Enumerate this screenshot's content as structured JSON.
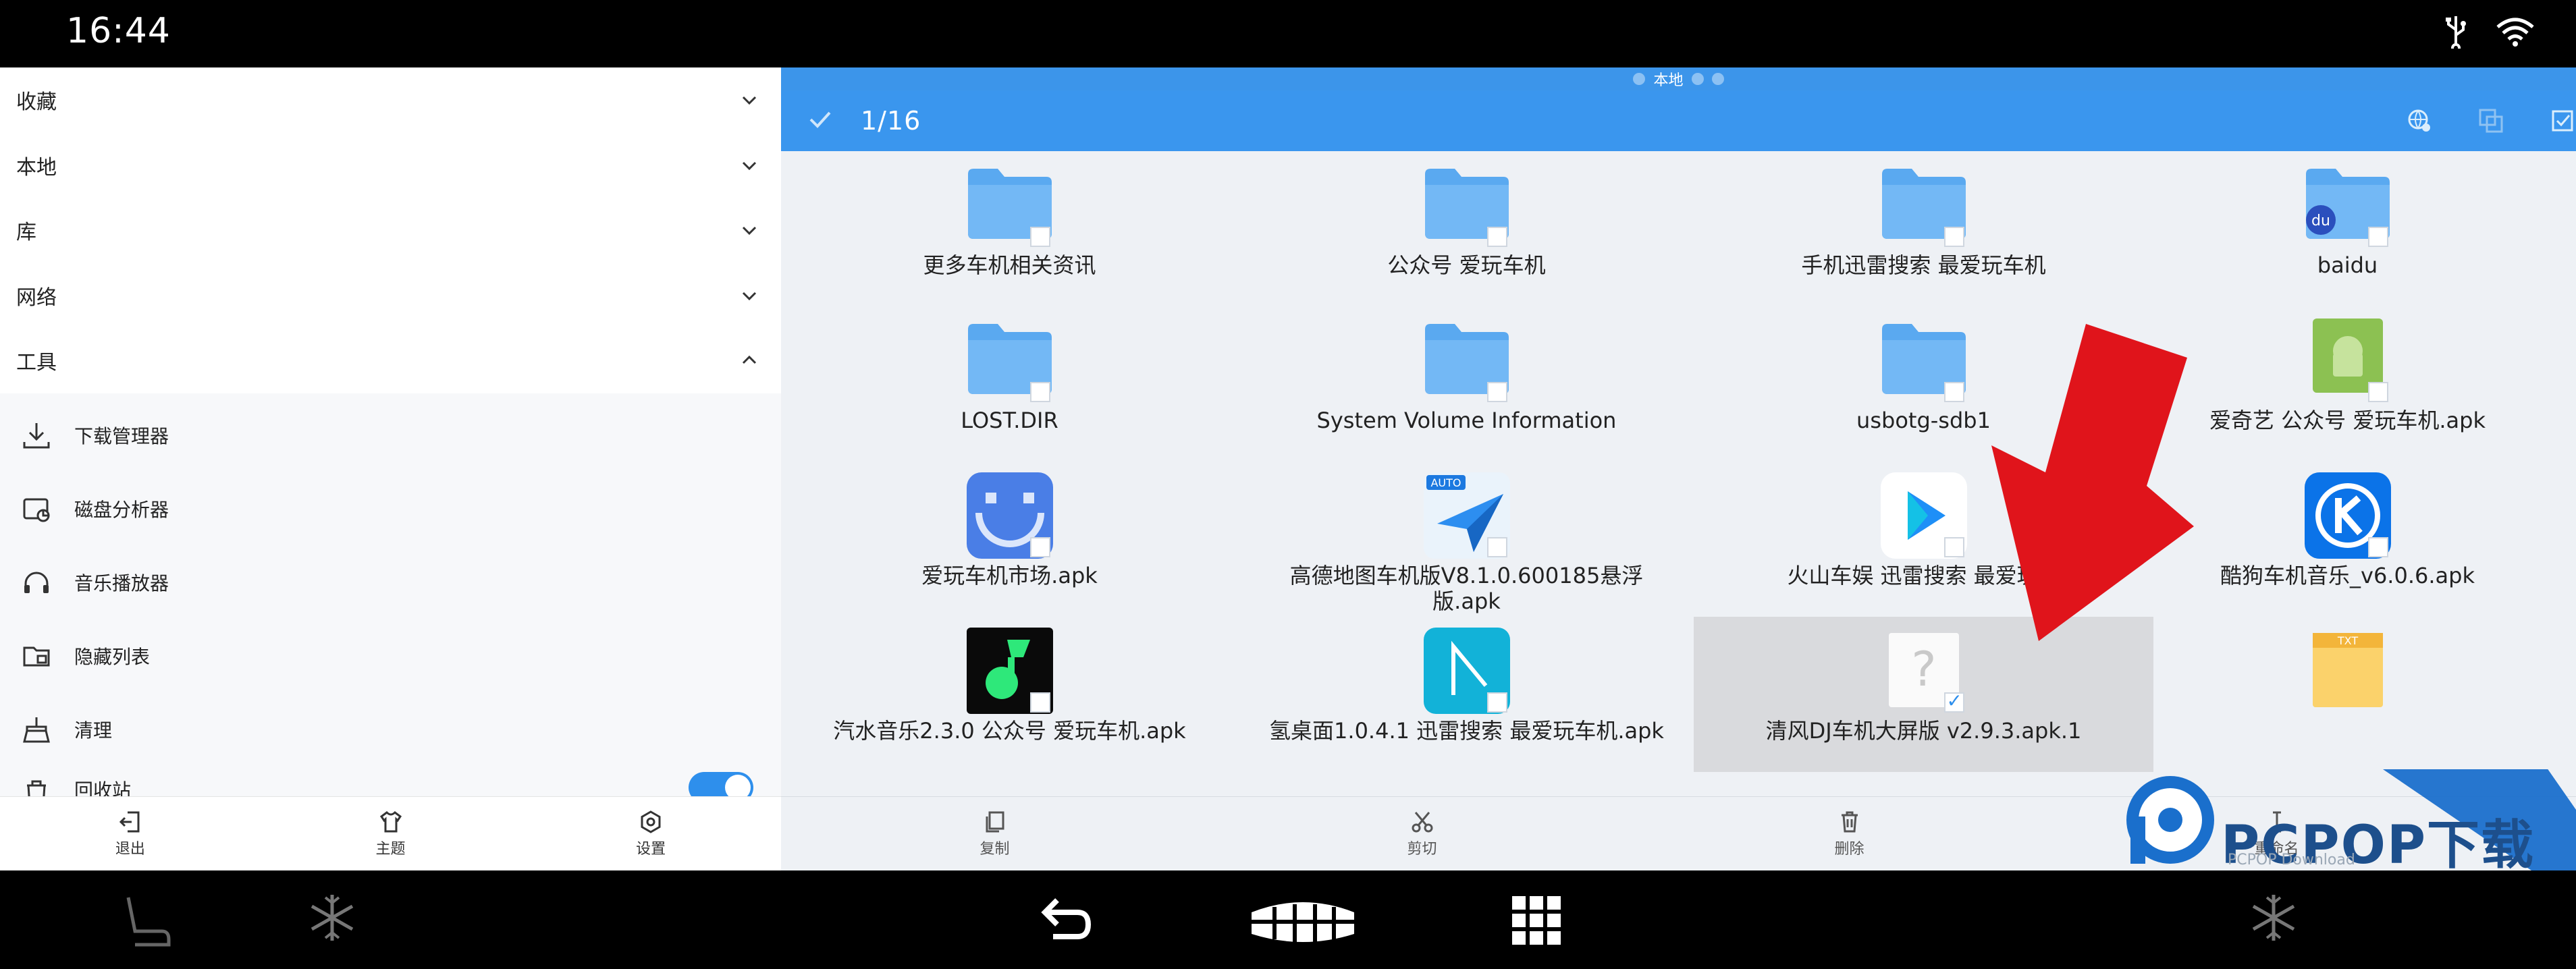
{
  "status_bar": {
    "time": "16:44",
    "icons": [
      "usb-icon",
      "wifi-icon"
    ]
  },
  "drawer": {
    "categories": [
      {
        "label": "收藏",
        "expanded": false
      },
      {
        "label": "本地",
        "expanded": false
      },
      {
        "label": "库",
        "expanded": false
      },
      {
        "label": "网络",
        "expanded": false
      },
      {
        "label": "工具",
        "expanded": true
      }
    ],
    "tools": [
      {
        "label": "下载管理器",
        "icon": "download-icon"
      },
      {
        "label": "磁盘分析器",
        "icon": "disk-analyzer-icon"
      },
      {
        "label": "音乐播放器",
        "icon": "headphones-icon"
      },
      {
        "label": "隐藏列表",
        "icon": "hidden-folder-icon"
      },
      {
        "label": "清理",
        "icon": "broom-icon"
      },
      {
        "label": "回收站",
        "icon": "trash-icon"
      }
    ],
    "bottom": [
      {
        "label": "退出",
        "icon": "exit-icon"
      },
      {
        "label": "主题",
        "icon": "shirt-icon"
      },
      {
        "label": "设置",
        "icon": "settings-icon"
      }
    ]
  },
  "file_browser": {
    "path": "本地",
    "selection_count": "1/16",
    "files": [
      {
        "name": "更多车机相关资讯",
        "type": "folder"
      },
      {
        "name": "公众号  爱玩车机",
        "type": "folder"
      },
      {
        "name": "手机迅雷搜索  最爱玩车机",
        "type": "folder"
      },
      {
        "name": "baidu",
        "type": "folder-baidu"
      },
      {
        "name": "LOST.DIR",
        "type": "folder"
      },
      {
        "name": "System Volume Information",
        "type": "folder"
      },
      {
        "name": "usbotg-sdb1",
        "type": "folder"
      },
      {
        "name": "爱奇艺   公众号  爱玩车机.apk",
        "type": "apk-android"
      },
      {
        "name": "爱玩车机市场.apk",
        "type": "apk-market"
      },
      {
        "name": "高德地图车机版V8.1.0.600185悬浮版.apk",
        "type": "apk-amap"
      },
      {
        "name": "火山车娱  迅雷搜索  最爱玩车",
        "type": "apk-huoshan"
      },
      {
        "name": "酷狗车机音乐_v6.0.6.apk",
        "type": "apk-kugou"
      },
      {
        "name": "汽水音乐2.3.0  公众号  爱玩车机.apk",
        "type": "apk-qishui"
      },
      {
        "name": "氢桌面1.0.4.1  迅雷搜索  最爱玩车机.apk",
        "type": "apk-qing"
      },
      {
        "name": "清风DJ车机大屏版  v2.9.3.apk.1",
        "type": "unknown",
        "selected": true
      },
      {
        "name": "",
        "type": "txt"
      }
    ],
    "bottom": [
      {
        "label": "复制",
        "icon": "copy-icon"
      },
      {
        "label": "剪切",
        "icon": "scissors-icon"
      },
      {
        "label": "删除",
        "icon": "delete-icon"
      },
      {
        "label": "重命名",
        "icon": "rename-icon"
      }
    ]
  },
  "watermark": {
    "text": "PCPOP下载",
    "sub": "PCPOP Download"
  },
  "colors": {
    "accent": "#3a96ee",
    "folder": "#5aa9f0",
    "arrow": "#e0141b"
  }
}
